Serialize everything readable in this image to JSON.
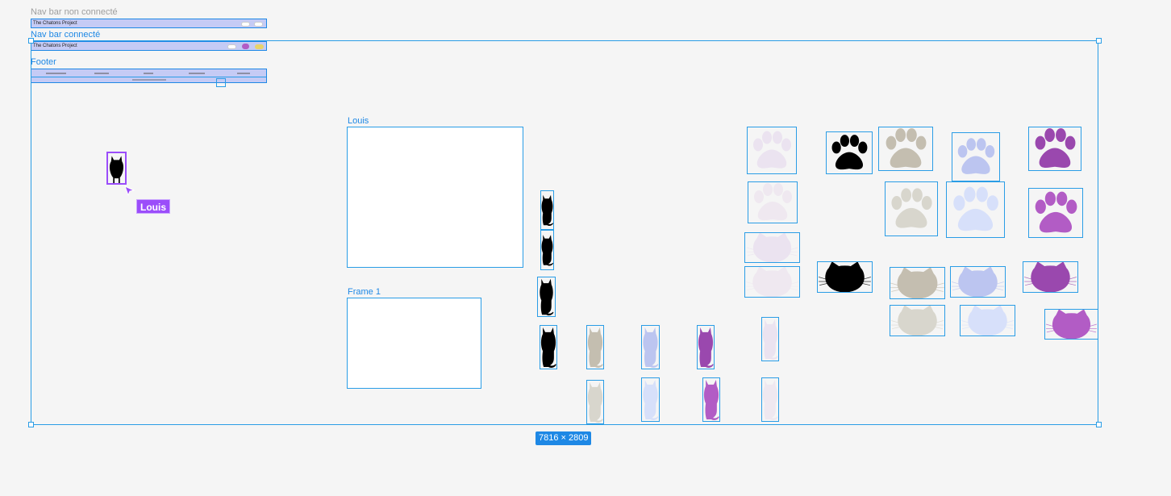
{
  "frames": {
    "nav_non_connecte": {
      "label": "Nav bar non connecté",
      "title": "The Chatons Project"
    },
    "nav_connecte": {
      "label": "Nav bar connecté",
      "title": "The Chatons Project"
    },
    "footer": {
      "label": "Footer"
    },
    "louis": {
      "label": "Louis"
    },
    "frame1": {
      "label": "Frame 1"
    }
  },
  "cursor": {
    "label": "Louis",
    "color": "#9b4dfa"
  },
  "selection": {
    "size": "7816 × 2809",
    "color": "#2a9de6"
  },
  "colors": {
    "black": "#000000",
    "beige": "#c4beb0",
    "light_beige": "#d8d6cd",
    "lavender": "#bcc5f0",
    "light_lavender": "#d7e0fa",
    "purple": "#9a48ae",
    "orchid": "#b25cc5",
    "pale_lilac": "#ebe3f0",
    "pale_pink": "#efe8f0"
  },
  "icons": [
    "cat-sitting-icon",
    "paw-icon",
    "cat-head-icon"
  ]
}
